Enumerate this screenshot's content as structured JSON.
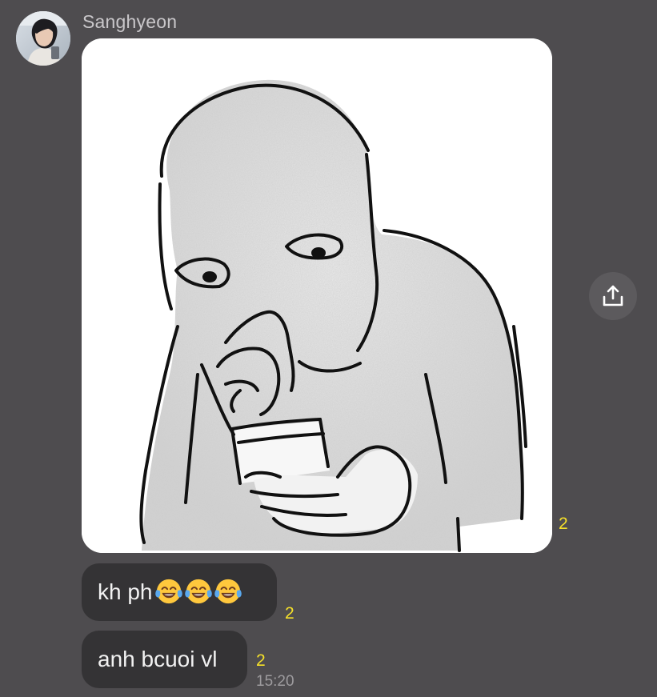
{
  "sender": {
    "name": "Sanghyeon"
  },
  "messages": [
    {
      "type": "image",
      "read_count": "2"
    },
    {
      "type": "text",
      "text": "kh ph",
      "emojis": [
        "face-with-tears-of-joy",
        "face-with-tears-of-joy",
        "face-with-tears-of-joy"
      ],
      "read_count": "2"
    },
    {
      "type": "text",
      "text": "anh bcuoi vl",
      "read_count": "2",
      "time": "15:20"
    }
  ],
  "icons": {
    "share": "share-upload-icon",
    "avatar": "user-avatar"
  },
  "colors": {
    "background": "#4e4c4f",
    "bubble": "#343335",
    "read_count": "#f5e02a",
    "timestamp": "#9d9b9e",
    "sender_name": "#c9c7ca"
  }
}
